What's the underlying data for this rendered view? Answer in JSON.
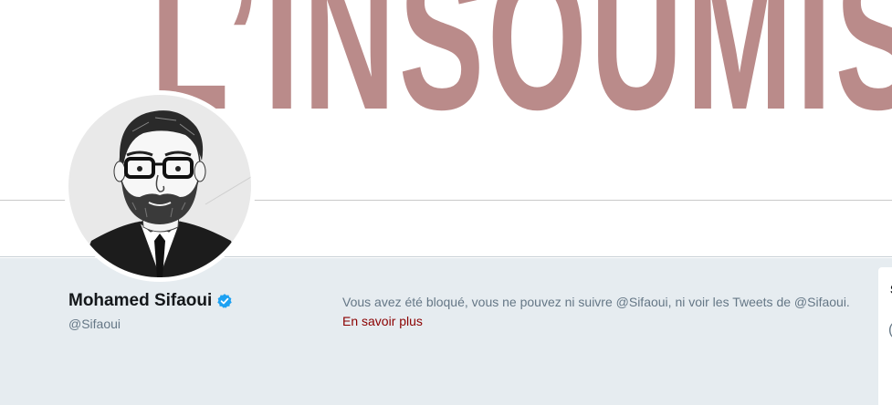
{
  "banner": {
    "text": "L’INSOUMISSI",
    "color": "#ba8b8a"
  },
  "profile": {
    "name": "Mohamed Sifaoui",
    "handle": "@Sifaoui",
    "verified_icon": "verified-badge-icon",
    "verified_color": "#1da1f2"
  },
  "blocked_notice": {
    "message": "Vous avez été bloqué, vous ne pouvez ni suivre @Sifaoui, ni voir les Tweets de @Sifaoui.",
    "link_label": "En savoir plus",
    "link_color": "#8b0000"
  },
  "side_card": {
    "letter": "S",
    "paren": "("
  }
}
